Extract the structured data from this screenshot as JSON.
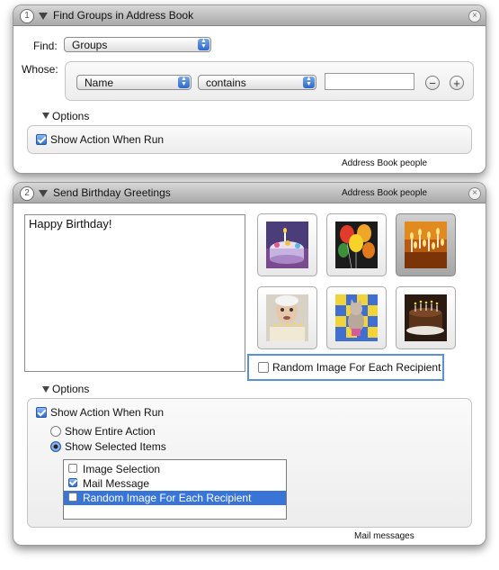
{
  "action1": {
    "number": "1",
    "title": "Find Groups in Address Book",
    "find_label": "Find:",
    "find_value": "Groups",
    "whose_label": "Whose:",
    "field_value": "Name",
    "operator_value": "contains",
    "text_value": "",
    "minus": "−",
    "plus": "+",
    "options_label": "Options",
    "show_action": "Show Action When Run",
    "show_action_checked": true,
    "output_label": "Address Book people"
  },
  "action2": {
    "number": "2",
    "title": "Send Birthday Greetings",
    "input_label": "Address Book people",
    "message_text": "Happy Birthday!",
    "images": [
      {
        "name": "birthday-cake-image",
        "selected": false
      },
      {
        "name": "balloons-image",
        "selected": false
      },
      {
        "name": "candles-image",
        "selected": true
      },
      {
        "name": "old-man-cake-image",
        "selected": false
      },
      {
        "name": "kitten-image",
        "selected": false
      },
      {
        "name": "chocolate-cake-image",
        "selected": false
      }
    ],
    "random_image": "Random Image For Each Recipient",
    "random_image_checked": false,
    "options_label": "Options",
    "show_action": "Show Action When Run",
    "show_action_checked": true,
    "show_entire": "Show Entire Action",
    "show_selected": "Show Selected Items",
    "selected_mode": "selected",
    "items": [
      {
        "label": "Image Selection",
        "checked": false,
        "highlighted": false
      },
      {
        "label": "Mail Message",
        "checked": true,
        "highlighted": false
      },
      {
        "label": "Random Image For Each Recipient",
        "checked": false,
        "highlighted": true
      }
    ],
    "output_label": "Mail messages"
  },
  "colors": {
    "accent": "#3875d7",
    "focus_ring": "#5b92cc"
  },
  "icons": {
    "close": "close-icon",
    "disclosure": "disclosure-triangle-icon"
  }
}
